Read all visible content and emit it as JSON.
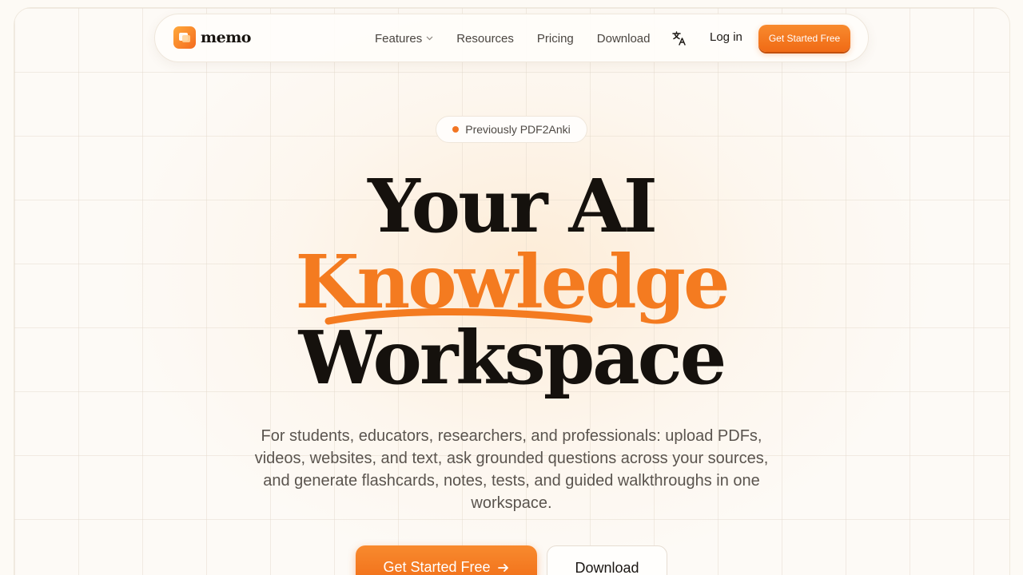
{
  "nav": {
    "brand": "memo",
    "links": [
      {
        "label": "Features",
        "has_dropdown": true
      },
      {
        "label": "Resources"
      },
      {
        "label": "Pricing"
      },
      {
        "label": "Download"
      }
    ],
    "language_icon": "translate-icon",
    "login": "Log in",
    "cta": "Get Started Free"
  },
  "hero": {
    "badge": "Previously PDF2Anki",
    "headline_line1": "Your AI",
    "headline_line2": "Knowledge",
    "headline_line3": "Workspace",
    "subtitle": "For students, educators, researchers, and professionals: upload PDFs, videos, websites, and text, ask grounded questions across your sources, and generate flashcards, notes, tests, and guided walkthroughs in one workspace.",
    "primary_button": "Get Started Free",
    "primary_button_icon": "arrow-right-icon",
    "secondary_button": "Download"
  },
  "colors": {
    "accent": "#f47b20",
    "background": "#fdfaf5",
    "text": "#15110d"
  }
}
